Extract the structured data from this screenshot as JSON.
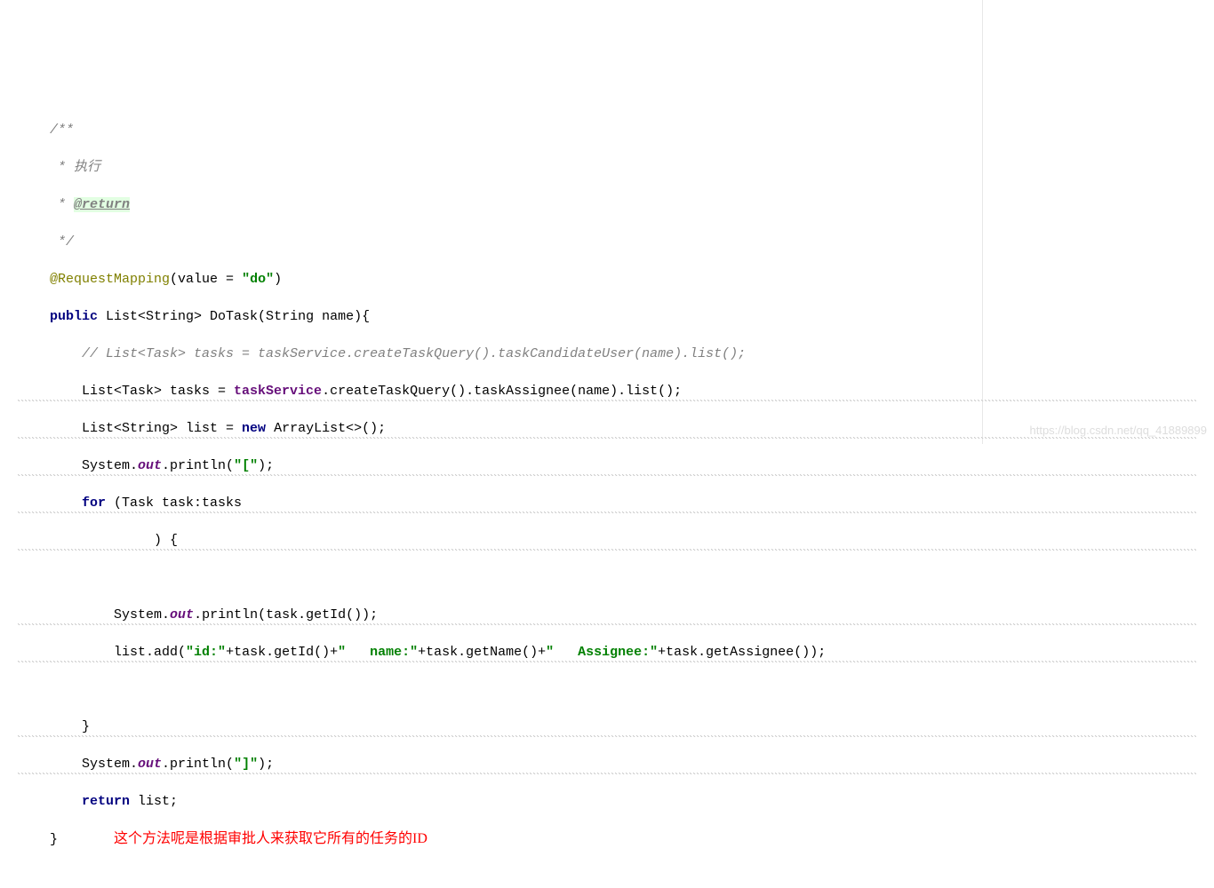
{
  "code": {
    "l1": "/**",
    "l2": " * 执行",
    "l3_prefix": " * ",
    "l3_tag": "@return",
    "l4": " */",
    "l5_anno": "@RequestMapping",
    "l5_paren": "(value = ",
    "l5_str": "\"do\"",
    "l5_end": ")",
    "l6_kw1": "public",
    "l6_mid": " List<String> DoTask(String name){",
    "l7_comment": "// List<Task> tasks = taskService.createTaskQuery().taskCandidateUser(name).list();",
    "l8_a": "List<Task> tasks = ",
    "l8_svc": "taskService",
    "l8_b": ".createTaskQuery().taskAssignee(name).list();",
    "l9_a": "List<String> list = ",
    "l9_kw": "new",
    "l9_b": " ArrayList<>();",
    "l10_a": "System.",
    "l10_out": "out",
    "l10_b": ".println(",
    "l10_str": "\"[\"",
    "l10_c": ");",
    "l11_kw": "for",
    "l11_a": " (Task task:tasks",
    "l12": "     ) {",
    "l13": "",
    "l14_a": "System.",
    "l14_out": "out",
    "l14_b": ".println(task.getId());",
    "l15_a": "list.add(",
    "l15_s1": "\"id:\"",
    "l15_b": "+task.getId()+",
    "l15_s2": "\"   name:\"",
    "l15_c": "+task.getName()+",
    "l15_s3": "\"   Assignee:\"",
    "l15_d": "+task.getAssignee());",
    "l16": "",
    "l17": "}",
    "l18_a": "System.",
    "l18_out": "out",
    "l18_b": ".println(",
    "l18_str": "\"]\"",
    "l18_c": ");",
    "l19_kw": "return",
    "l19_a": " list;",
    "l20": "}",
    "annotation_cn": "这个方法呢是根据审批人来获取它所有的任务的ID"
  },
  "watermark": "https://blog.csdn.net/qq_41889899"
}
